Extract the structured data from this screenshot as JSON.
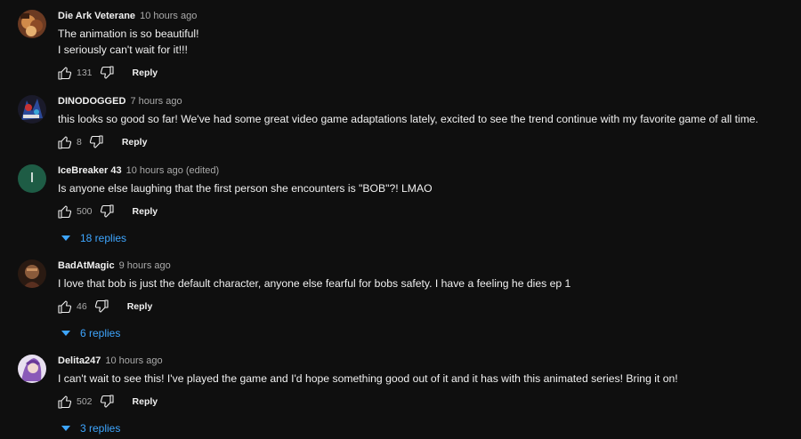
{
  "comments": [
    {
      "author": "Die Ark Veterane",
      "time": "10 hours ago",
      "lines": [
        "The animation is so beautiful!",
        "I seriously can't wait for it!!!"
      ],
      "likes": "131",
      "reply_label": "Reply"
    },
    {
      "author": "DINODOGGED",
      "time": "7 hours ago",
      "lines": [
        "this looks so good so far! We've had some great video game adaptations lately, excited to see the trend continue with my favorite game of all time."
      ],
      "likes": "8",
      "reply_label": "Reply"
    },
    {
      "author": "IceBreaker 43",
      "time": "10 hours ago (edited)",
      "avatar_letter": "I",
      "lines": [
        "Is anyone else laughing that the first person she encounters is \"BOB\"?! LMAO"
      ],
      "likes": "500",
      "reply_label": "Reply",
      "replies_label": "18 replies"
    },
    {
      "author": "BadAtMagic",
      "time": "9 hours ago",
      "lines": [
        "I love that bob is just the default character, anyone else fearful for bobs safety. I have a feeling he dies ep 1"
      ],
      "likes": "46",
      "reply_label": "Reply",
      "replies_label": "6 replies"
    },
    {
      "author": "Delita247",
      "time": "10 hours ago",
      "lines": [
        "I can't wait to see this! I've played the game and I'd hope something good out of it and it has with this animated series! Bring it on!"
      ],
      "likes": "502",
      "reply_label": "Reply",
      "replies_label": "3 replies"
    }
  ],
  "icons": {
    "like": "thumbs-up-icon",
    "dislike": "thumbs-down-icon",
    "expand": "caret-down-icon"
  },
  "colors": {
    "background": "#0f0f0f",
    "link": "#3ea6ff",
    "muted": "#aaaaaa",
    "text": "#f1f1f1"
  }
}
